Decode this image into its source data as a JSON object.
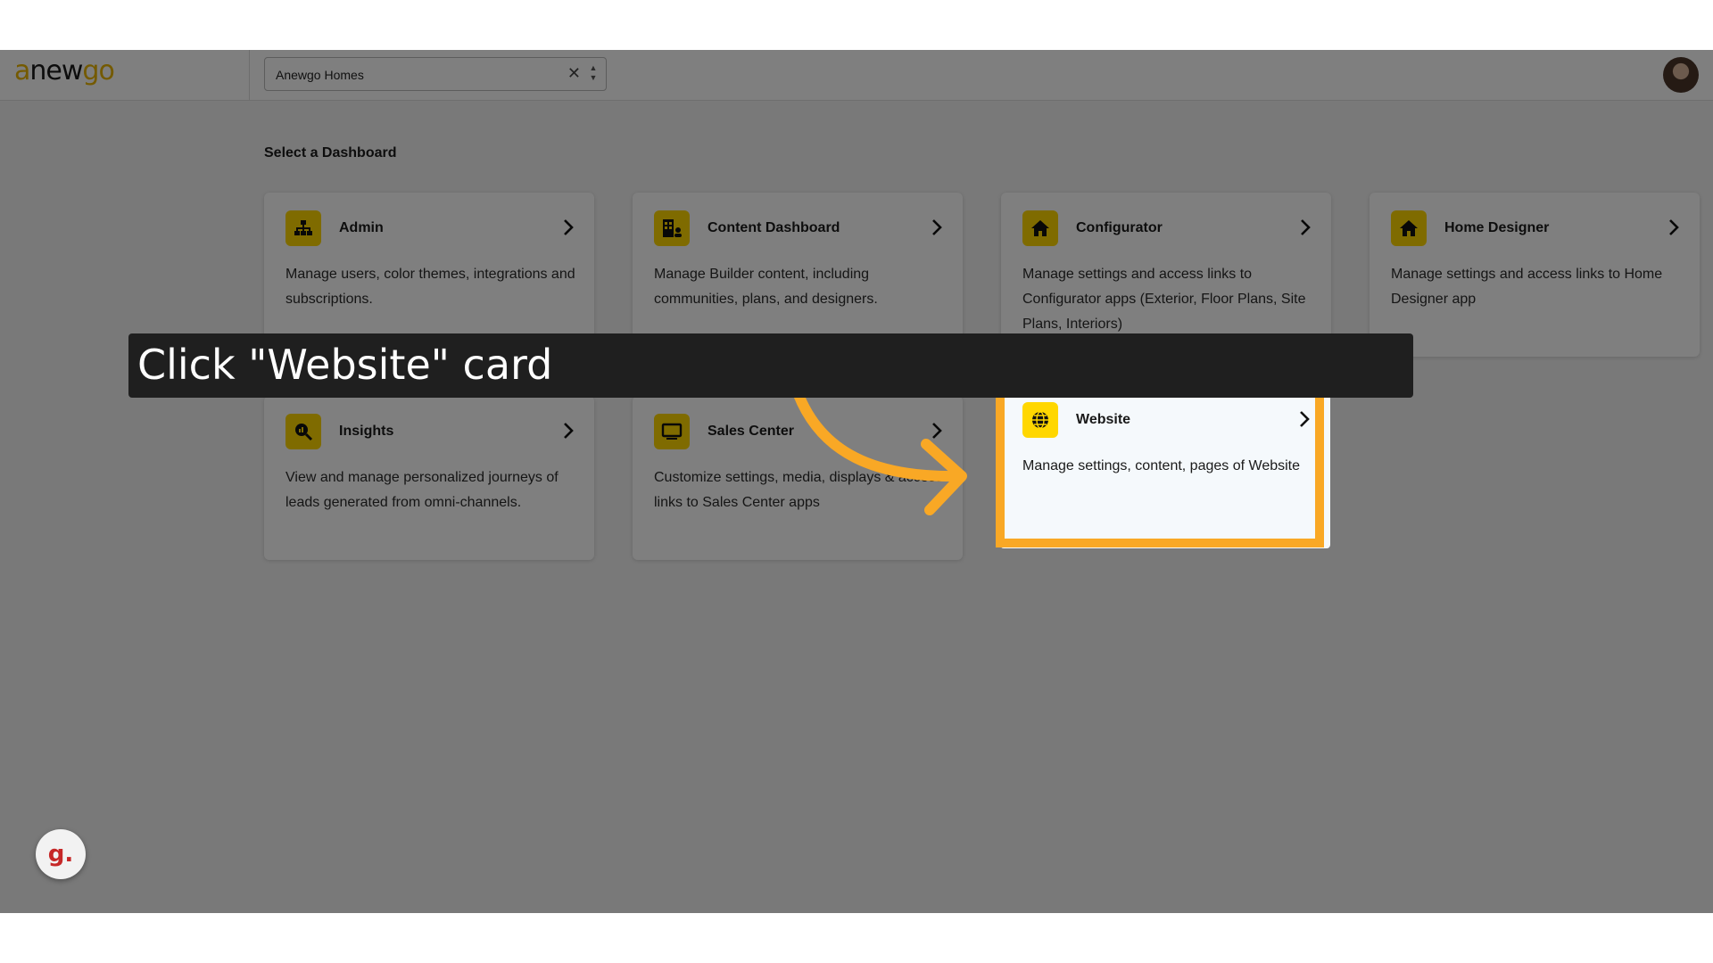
{
  "app": {
    "logo_left": "a",
    "logo_mid": "new",
    "logo_right": "go",
    "builder_select": {
      "value": "Anewgo Homes",
      "clear_icon": "close-icon",
      "toggle_icon": "chevron-updown-icon"
    }
  },
  "main": {
    "heading": "Select a Dashboard",
    "cards": [
      {
        "title": "Admin",
        "description": "Manage users, color themes, integrations and subscriptions.",
        "icon": "sitemap-icon"
      },
      {
        "title": "Content Dashboard",
        "description": "Manage Builder content, including communities, plans, and designers.",
        "icon": "building-user-icon"
      },
      {
        "title": "Configurator",
        "description": "Manage settings and access links to Configurator apps (Exterior, Floor Plans, Site Plans, Interiors)",
        "icon": "home-icon"
      },
      {
        "title": "Home Designer",
        "description": "Manage settings and access links to Home Designer app",
        "icon": "home-icon"
      },
      {
        "title": "Insights",
        "description": "View and manage personalized journeys of leads generated from omni-channels.",
        "icon": "search-chart-icon"
      },
      {
        "title": "Sales Center",
        "description": "Customize settings, media, displays & access links to Sales Center apps",
        "icon": "monitor-icon"
      },
      {
        "title": "Website",
        "description": "Manage settings, content, pages of Website",
        "icon": "globe-icon"
      }
    ]
  },
  "tutorial": {
    "instruction": "Click \"Website\" card",
    "fab_label": "g.",
    "accent_color": "#f9a825"
  }
}
